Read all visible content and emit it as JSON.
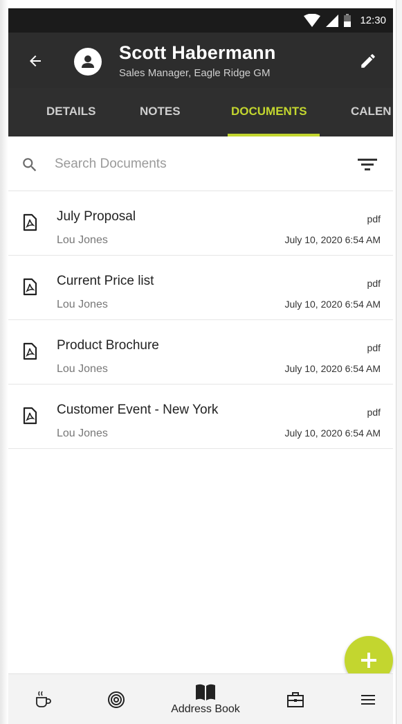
{
  "status_bar": {
    "time": "12:30"
  },
  "contact": {
    "name": "Scott Habermann",
    "subtitle": "Sales Manager, Eagle Ridge GM"
  },
  "tabs": [
    {
      "label": "DETAILS"
    },
    {
      "label": "NOTES"
    },
    {
      "label": "DOCUMENTS",
      "active": true
    },
    {
      "label": "CALEN"
    }
  ],
  "search": {
    "placeholder": "Search Documents",
    "value": ""
  },
  "documents": [
    {
      "title": "July Proposal",
      "author": "Lou Jones",
      "type": "pdf",
      "date": "July 10, 2020 6:54 AM",
      "icon": "pdf-file-icon"
    },
    {
      "title": "Current Price list",
      "author": "Lou Jones",
      "type": "pdf",
      "date": "July 10, 2020 6:54 AM",
      "icon": "pdf-file-icon"
    },
    {
      "title": "Product Brochure",
      "author": "Lou Jones",
      "type": "pdf",
      "date": "July 10, 2020 6:54 AM",
      "icon": "pdf-file-icon"
    },
    {
      "title": "Customer Event - New York",
      "author": "Lou Jones",
      "type": "pdf",
      "date": "July 10, 2020 6:54 AM",
      "icon": "pdf-file-icon"
    }
  ],
  "bottom_nav": {
    "items": [
      {
        "icon": "coffee-cup-icon"
      },
      {
        "icon": "target-icon"
      },
      {
        "icon": "book-icon",
        "label": "Address Book",
        "active": true
      },
      {
        "icon": "briefcase-icon"
      },
      {
        "icon": "menu-icon"
      }
    ]
  },
  "colors": {
    "accent": "#c3d62f",
    "header_bg": "#2d2d2d",
    "tabs_bg": "#2f2f2f",
    "status_bg": "#1b1b1b"
  }
}
